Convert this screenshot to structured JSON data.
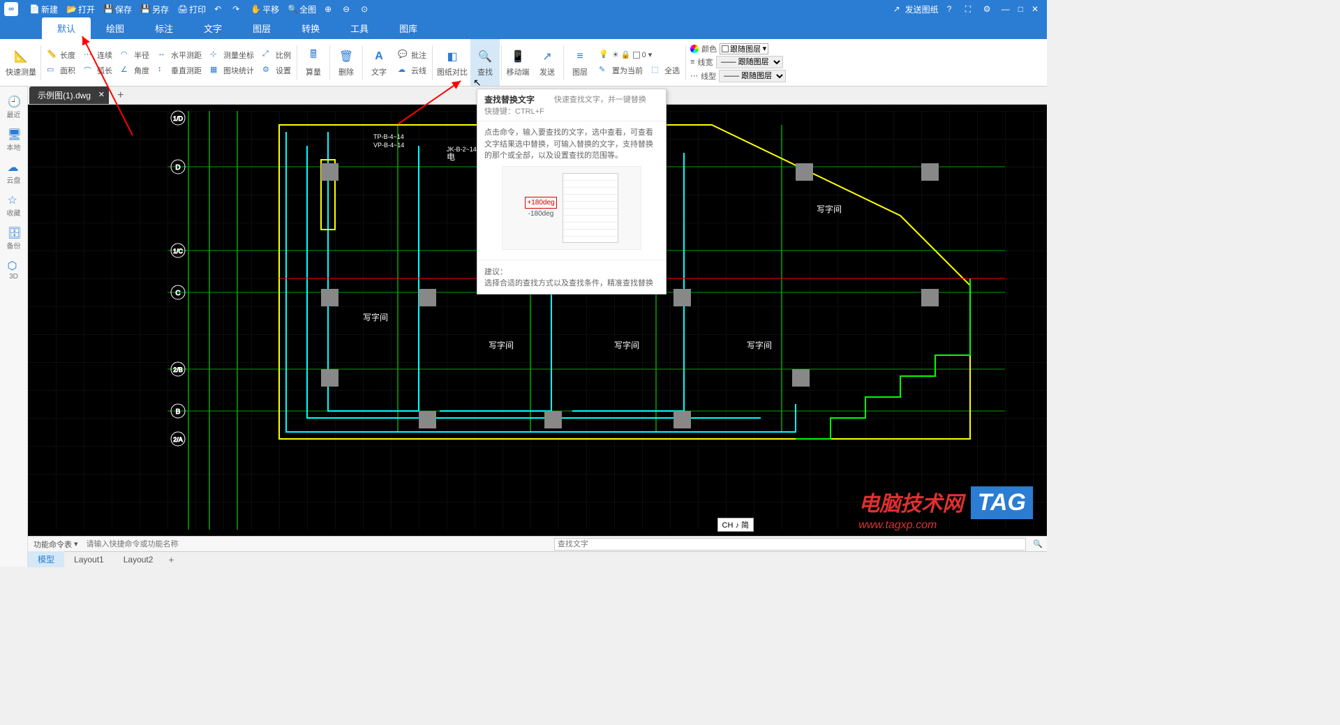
{
  "titlebar": {
    "new": "新建",
    "open": "打开",
    "save": "保存",
    "saveas": "另存",
    "print": "打印",
    "pan": "平移",
    "fullview": "全图",
    "send_drawing": "发送图纸"
  },
  "menutabs": {
    "default": "默认",
    "draw": "绘图",
    "annotate": "标注",
    "text": "文字",
    "layer": "图层",
    "convert": "转换",
    "tool": "工具",
    "gallery": "图库"
  },
  "ribbon": {
    "quickmeasure": "快速测量",
    "length": "长度",
    "area": "面积",
    "continuous": "连续",
    "arclen": "弧长",
    "radius": "半径",
    "angle": "角度",
    "hdist": "水平测距",
    "vdist": "垂直测距",
    "surveycoord": "测量坐标",
    "blockstats": "图块统计",
    "scale": "比例",
    "settings": "设置",
    "calc": "算量",
    "delete": "删除",
    "text": "文字",
    "cloud": "云线",
    "annotate": "批注",
    "compare": "图纸对比",
    "find": "查找",
    "mobile": "移动端",
    "send": "发送",
    "layer": "图层",
    "setcurrent": "置为当前",
    "selectall": "全选",
    "color": "颜色",
    "lineweight": "线宽",
    "linetype": "线型",
    "bylayer": "跟随图层",
    "zero": "0"
  },
  "sidebar": {
    "recent": "最近",
    "local": "本地",
    "cloud": "云盘",
    "favorites": "收藏",
    "backup": "备份",
    "threed": "3D"
  },
  "filetab": {
    "name": "示例图(1).dwg"
  },
  "tooltip": {
    "title": "查找替换文字",
    "shortcut": "快捷键：CTRL+F",
    "short_desc": "快速查找文字，并一键替换",
    "body": "点击命令，输入要查找的文字，选中查看，可查看文字结果选中替换，可输入替换的文字，支持替换的那个或全部，以及设置查找的范围等。",
    "example_pos": "+180deg",
    "example_neg": "-180deg",
    "suggest_label": "建议：",
    "suggest_body": "选择合适的查找方式以及查找条件，精准查找替换"
  },
  "canvas_labels": {
    "office": "写字间",
    "grid_d": "D",
    "grid_c": "C",
    "grid_b": "B",
    "grid_a2": "2/A",
    "grid_1d": "1/D",
    "grid_1c": "1/C",
    "elec": "电",
    "tp": "TP-B-4~14",
    "vp": "VP-B-4~14",
    "jk": "JK-B-2~14"
  },
  "cmdbar": {
    "label": "功能命令表",
    "placeholder": "请输入快捷命令或功能名称",
    "find_placeholder": "查找文字"
  },
  "inputhint": "CH ♪ 简",
  "layouttabs": {
    "model": "模型",
    "layout1": "Layout1",
    "layout2": "Layout2"
  },
  "watermark": {
    "line1": "电脑技术网",
    "line2": "www.tagxp.com",
    "tag": "TAG"
  }
}
